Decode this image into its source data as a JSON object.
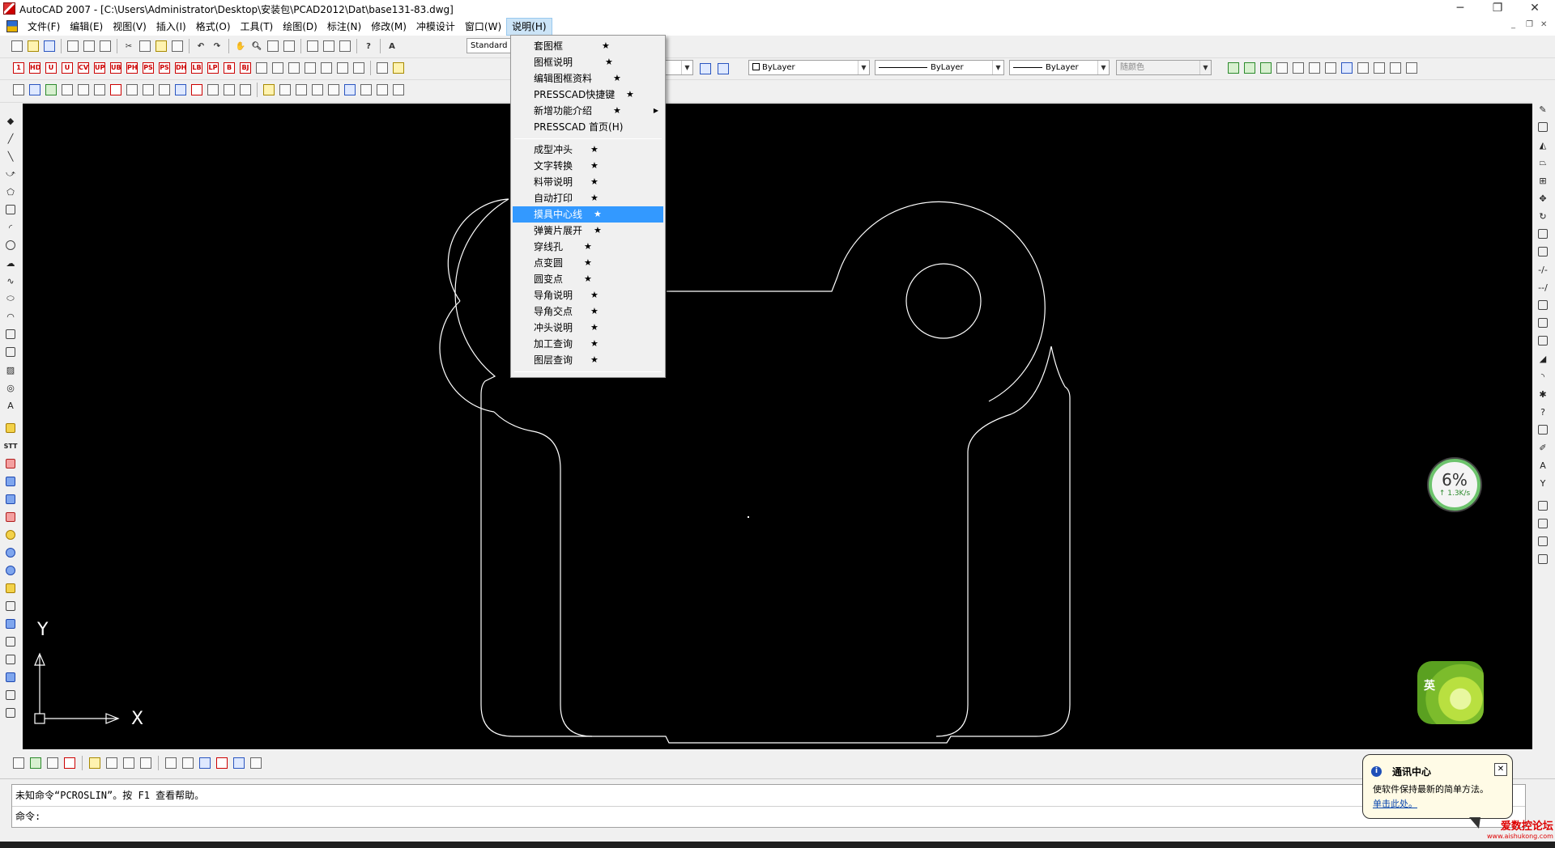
{
  "window": {
    "title": "AutoCAD 2007 - [C:\\Users\\Administrator\\Desktop\\安装包\\PCAD2012\\Dat\\base131-83.dwg]",
    "minimize": "─",
    "restore": "❐",
    "close": "✕"
  },
  "menubar": {
    "items": [
      "文件(F)",
      "编辑(E)",
      "视图(V)",
      "插入(I)",
      "格式(O)",
      "工具(T)",
      "绘图(D)",
      "标注(N)",
      "修改(M)",
      "冲模设计",
      "窗口(W)",
      "说明(H)"
    ],
    "active": "说明(H)"
  },
  "toolbar": {
    "text_style": "Standard",
    "color_combo": "ByLayer",
    "linetype_combo": "ByLayer",
    "lineweight_combo": "ByLayer",
    "plotstyle_combo": "随颜色"
  },
  "dropdown": {
    "items": [
      {
        "label": "套图框",
        "star": "★"
      },
      {
        "label": "图框说明",
        "star": "★"
      },
      {
        "label": "编辑图框资料",
        "star": "★"
      },
      {
        "label": "PRESSCAD快捷键",
        "star": "★"
      },
      {
        "label": "新增功能介绍",
        "star": "★"
      },
      {
        "label": "PRESSCAD 首页(H)",
        "star": ""
      },
      {
        "label": "成型冲头",
        "star": "★"
      },
      {
        "label": "文字转换",
        "star": "★"
      },
      {
        "label": "料带说明",
        "star": "★"
      },
      {
        "label": "自动打印",
        "star": "★"
      },
      {
        "label": "摸具中心线",
        "star": "★"
      },
      {
        "label": "弹簧片展开",
        "star": "★"
      },
      {
        "label": "穿线孔",
        "star": "★"
      },
      {
        "label": "点变圆",
        "star": "★"
      },
      {
        "label": "圆变点",
        "star": "★"
      },
      {
        "label": "导角说明",
        "star": "★"
      },
      {
        "label": "导角交点",
        "star": "★"
      },
      {
        "label": "冲头说明",
        "star": "★"
      },
      {
        "label": "加工查询",
        "star": "★"
      },
      {
        "label": "图层查询",
        "star": "★"
      }
    ],
    "highlighted": "摸具中心线"
  },
  "ucs": {
    "x_label": "X",
    "y_label": "Y"
  },
  "command": {
    "history": "未知命令“PCROSLIN”。按 F1 查看帮助。",
    "prompt": "命令:"
  },
  "notification": {
    "title": "通讯中心",
    "text": "使软件保持最新的简单方法。",
    "link": "单击此处。",
    "info_icon": "i",
    "close": "✕"
  },
  "netmeter": {
    "percent": "6%",
    "speed": "↑ 1.3K/s"
  },
  "ime": {
    "label": "英"
  },
  "watermark": {
    "site": "爱数控论坛",
    "url": "www.aishukong.com"
  },
  "colors": {
    "canvas": "#000000",
    "highlight": "#3399ff",
    "drawing_line": "#ffffff"
  }
}
